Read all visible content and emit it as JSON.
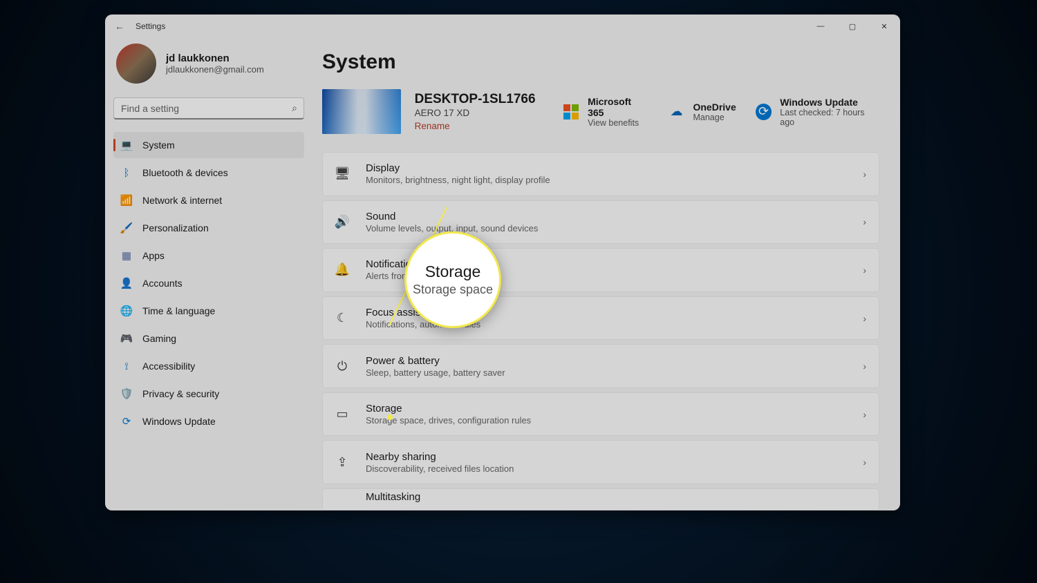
{
  "titlebar": {
    "app_name": "Settings"
  },
  "profile": {
    "name": "jd laukkonen",
    "email": "jdlaukkonen@gmail.com"
  },
  "search": {
    "placeholder": "Find a setting"
  },
  "nav": [
    {
      "label": "System",
      "icon": "💻",
      "icon_name": "system-icon",
      "active": true
    },
    {
      "label": "Bluetooth & devices",
      "icon": "ᛒ",
      "icon_name": "bluetooth-icon",
      "icon_color": "#0078d4"
    },
    {
      "label": "Network & internet",
      "icon": "📶",
      "icon_name": "network-icon"
    },
    {
      "label": "Personalization",
      "icon": "🖌️",
      "icon_name": "personalization-icon"
    },
    {
      "label": "Apps",
      "icon": "▦",
      "icon_name": "apps-icon",
      "icon_color": "#5b6ea5"
    },
    {
      "label": "Accounts",
      "icon": "👤",
      "icon_name": "accounts-icon",
      "icon_color": "#2e8b3c"
    },
    {
      "label": "Time & language",
      "icon": "🌐",
      "icon_name": "time-language-icon"
    },
    {
      "label": "Gaming",
      "icon": "🎮",
      "icon_name": "gaming-icon"
    },
    {
      "label": "Accessibility",
      "icon": "⟟",
      "icon_name": "accessibility-icon",
      "icon_color": "#0078d4"
    },
    {
      "label": "Privacy & security",
      "icon": "🛡️",
      "icon_name": "privacy-icon"
    },
    {
      "label": "Windows Update",
      "icon": "⟳",
      "icon_name": "update-icon",
      "icon_color": "#0078d4"
    }
  ],
  "page_title": "System",
  "device": {
    "name": "DESKTOP-1SL1766",
    "model": "AERO 17 XD",
    "rename": "Rename"
  },
  "cloud": {
    "ms365": {
      "title": "Microsoft 365",
      "sub": "View benefits"
    },
    "onedrive": {
      "title": "OneDrive",
      "sub": "Manage"
    },
    "update": {
      "title": "Windows Update",
      "sub": "Last checked: 7 hours ago"
    }
  },
  "cards": [
    {
      "title": "Display",
      "sub": "Monitors, brightness, night light, display profile",
      "icon": "🖥",
      "icon_name": "display-icon"
    },
    {
      "title": "Sound",
      "sub": "Volume levels, output, input, sound devices",
      "icon": "🔊",
      "icon_name": "sound-icon"
    },
    {
      "title": "Notifications",
      "sub": "Alerts from apps and system",
      "icon": "🔔",
      "icon_name": "notifications-icon"
    },
    {
      "title": "Focus assist",
      "sub": "Notifications, automatic rules",
      "icon": "☾",
      "icon_name": "focus-assist-icon"
    },
    {
      "title": "Power & battery",
      "sub": "Sleep, battery usage, battery saver",
      "icon": "⏻",
      "icon_name": "power-icon"
    },
    {
      "title": "Storage",
      "sub": "Storage space, drives, configuration rules",
      "icon": "▭",
      "icon_name": "storage-icon"
    },
    {
      "title": "Nearby sharing",
      "sub": "Discoverability, received files location",
      "icon": "⇪",
      "icon_name": "nearby-sharing-icon"
    },
    {
      "title": "Multitasking",
      "sub": "",
      "icon": "",
      "icon_name": "multitasking-icon",
      "cut": true
    }
  ],
  "lens": {
    "title": "Storage",
    "sub": "Storage space"
  }
}
